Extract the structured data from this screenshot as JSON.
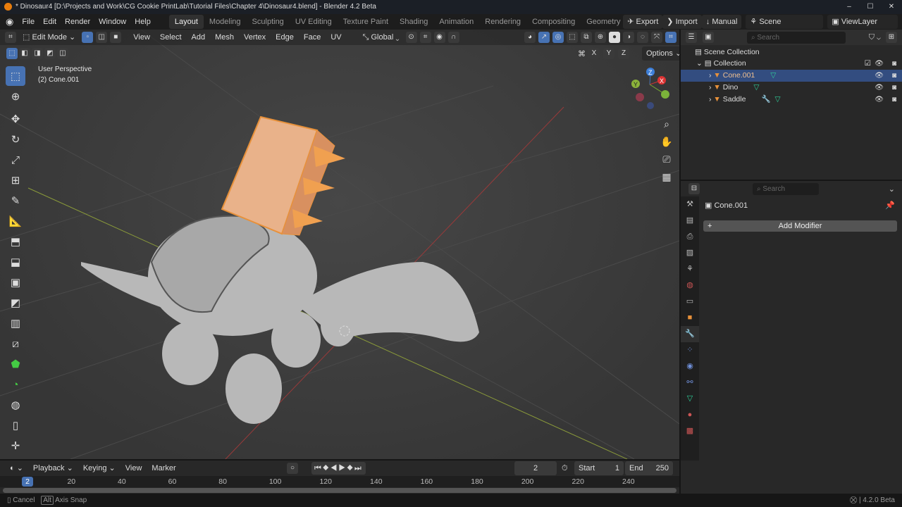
{
  "title": "* Dinosaur4 [D:\\Projects and Work\\CG Cookie PrintLab\\Tutorial Files\\Chapter 4\\Dinosaur4.blend] - Blender 4.2 Beta",
  "window_controls": {
    "minimize": "–",
    "maximize": "☐",
    "close": "✕"
  },
  "menu": [
    "File",
    "Edit",
    "Render",
    "Window",
    "Help"
  ],
  "workspaces": [
    "Layout",
    "Modeling",
    "Sculpting",
    "UV Editing",
    "Texture Paint",
    "Shading",
    "Animation",
    "Rendering",
    "Compositing",
    "Geometry N"
  ],
  "addon_buttons": {
    "export": "Export",
    "import": "Import",
    "manual": "Manual"
  },
  "scene": "Scene",
  "view_layer": "ViewLayer",
  "viewport_header": {
    "mode": "Edit Mode",
    "menus": [
      "View",
      "Select",
      "Add",
      "Mesh",
      "Vertex",
      "Edge",
      "Face",
      "UV"
    ],
    "orientation": "Global",
    "axes": [
      "X",
      "Y",
      "Z"
    ],
    "options": "Options"
  },
  "viewport": {
    "view_name": "User Perspective",
    "object_info": "(2) Cone.001",
    "gizmo": {
      "z": "Z",
      "y": "Y",
      "x": "X"
    }
  },
  "outliner": {
    "search_placeholder": "Search",
    "scene_collection": "Scene Collection",
    "collection": "Collection",
    "objects": [
      {
        "name": "Cone.001",
        "selected": true
      },
      {
        "name": "Dino",
        "selected": false
      },
      {
        "name": "Saddle",
        "selected": false
      }
    ]
  },
  "properties": {
    "search_placeholder": "Search",
    "object": "Cone.001",
    "add_modifier": "Add Modifier"
  },
  "timeline": {
    "menus": [
      "Playback",
      "Keying",
      "View",
      "Marker"
    ],
    "current_frame": "2",
    "start_label": "Start",
    "start": "1",
    "end_label": "End",
    "end": "250",
    "ticks": [
      "20",
      "40",
      "60",
      "80",
      "100",
      "120",
      "140",
      "160",
      "180",
      "200",
      "220",
      "240"
    ],
    "playhead": "2"
  },
  "status": {
    "cancel": "Cancel",
    "alt": "Alt",
    "axis_snap": "Axis Snap",
    "version": "4.2.0 Beta"
  },
  "colors": {
    "accent": "#4772b3",
    "selection": "#e8913a",
    "mesh_data": "#2fcf9a"
  }
}
